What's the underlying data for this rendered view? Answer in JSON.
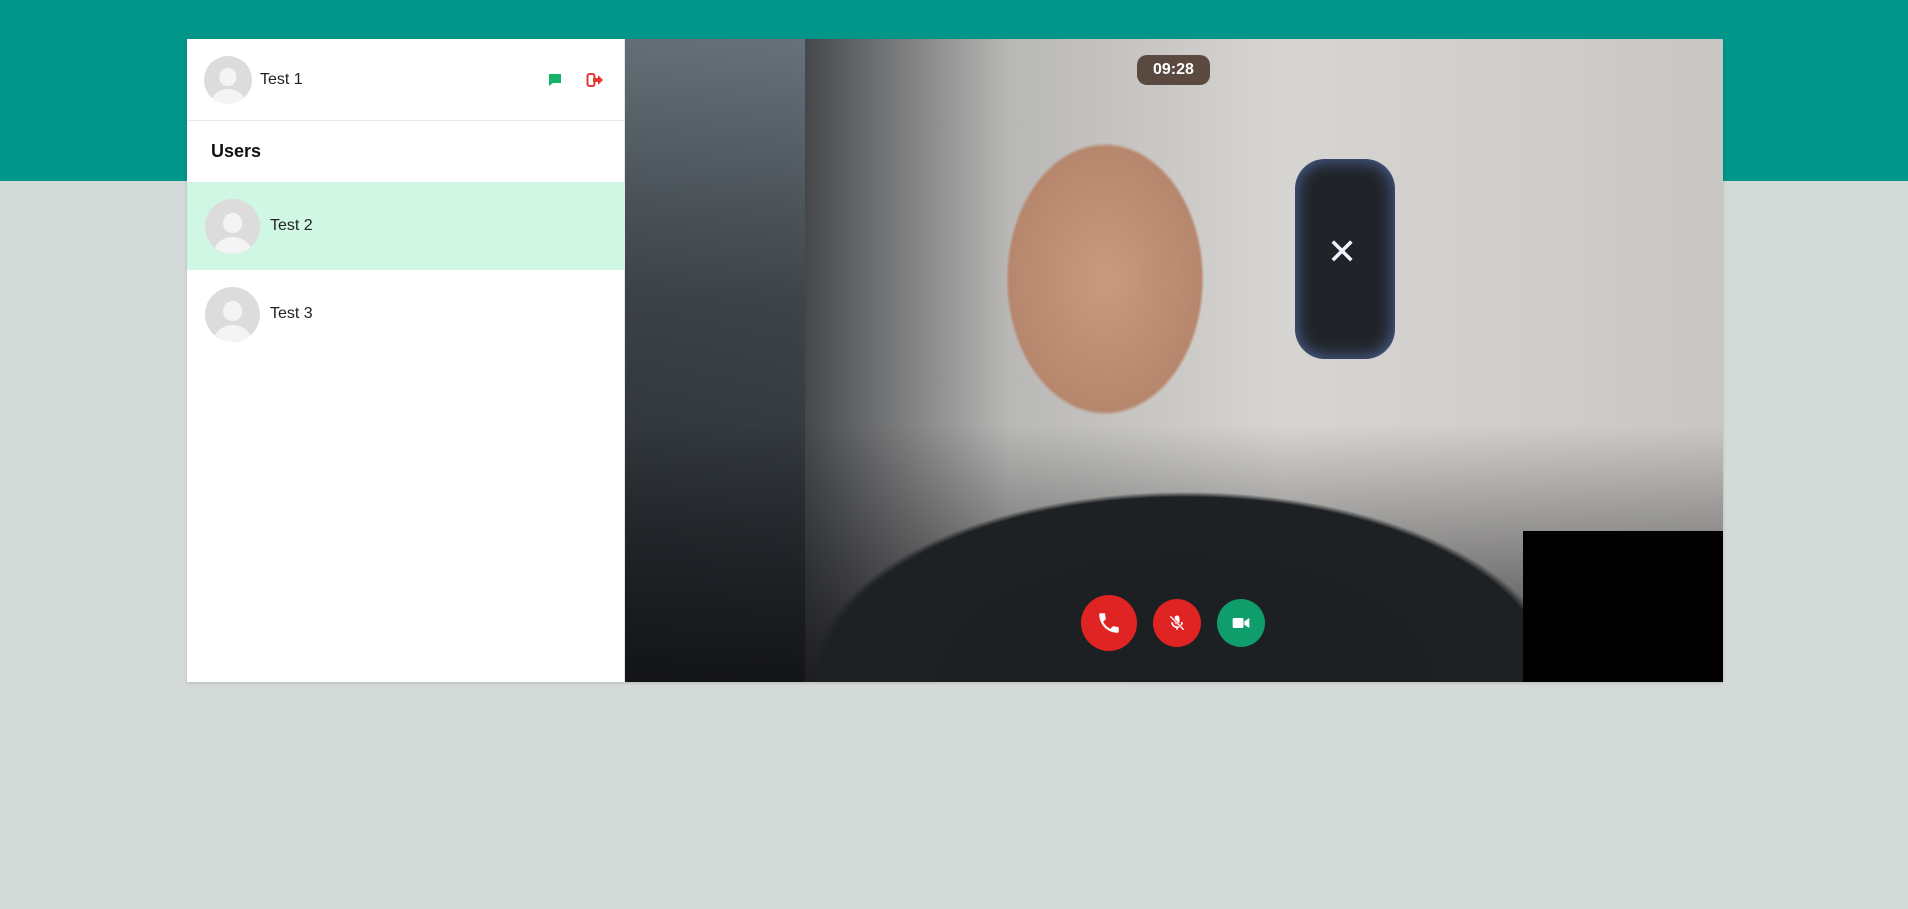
{
  "current_user": {
    "name": "Test 1"
  },
  "sidebar": {
    "title": "Users",
    "users": [
      {
        "name": "Test 2",
        "active": true
      },
      {
        "name": "Test 3",
        "active": false
      }
    ]
  },
  "call": {
    "timer": "09:28"
  },
  "icons": {
    "chat": "chat-icon",
    "logout": "logout-icon",
    "end_call": "phone-icon",
    "mute": "microphone-slash-icon",
    "camera": "video-camera-icon"
  },
  "colors": {
    "header": "#00968a",
    "background": "#d4dad8",
    "active_user": "#d0f7e4",
    "accent_green": "#0f9d6b",
    "danger_red": "#e02424"
  }
}
